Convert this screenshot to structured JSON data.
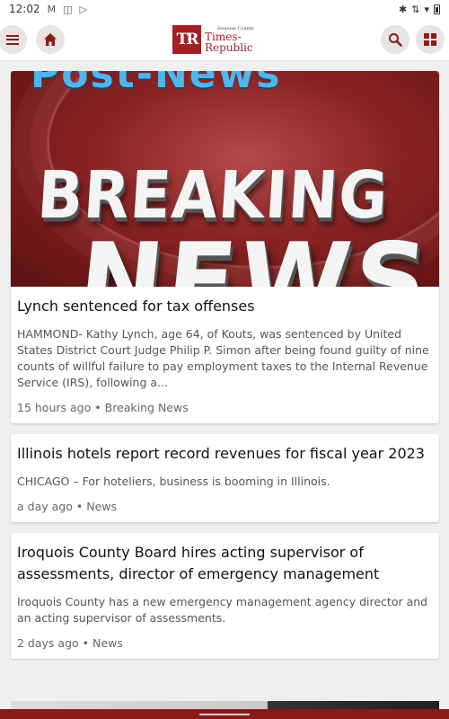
{
  "status_bar": {
    "time": "12:02",
    "left_icons": [
      "gmail-icon",
      "media-icon",
      "play-store-icon"
    ],
    "right_icons": [
      "bluetooth-icon",
      "data-icon",
      "wifi-icon",
      "battery-icon"
    ]
  },
  "app_bar": {
    "logo_mark": "TR",
    "logo_small": "Iroquois County",
    "logo_line1": "Times-",
    "logo_line2": "Republic",
    "menu_icon": "hamburger-menu-icon",
    "home_icon": "home-icon",
    "search_icon": "search-icon",
    "grid_icon": "grid-icon",
    "accent_color": "#a31f24"
  },
  "hero_image": {
    "top_text": "Post-News",
    "line1": "BREAKING",
    "line2": "NEWS"
  },
  "articles": [
    {
      "title": "Lynch sentenced for tax offenses",
      "excerpt": "HAMMOND- Kathy Lynch, age 64, of Kouts, was sentenced by United States District Court Judge Philip P. Simon after being found guilty of nine counts of willful failure to pay employment taxes to the Internal Revenue Service (IRS), following a...",
      "time": "15 hours ago",
      "category": "Breaking News"
    },
    {
      "title": "Illinois hotels report record revenues for fiscal year 2023",
      "excerpt": "CHICAGO – For hoteliers, business is booming in Illinois.",
      "time": "a day ago",
      "category": "News"
    },
    {
      "title": "Iroquois County Board hires acting supervisor of assessments, director of emergency management",
      "excerpt": "Iroquois County has a new emergency management agency director and an acting supervisor of assessments.",
      "time": "2 days ago",
      "category": "News"
    }
  ],
  "separator": "•"
}
